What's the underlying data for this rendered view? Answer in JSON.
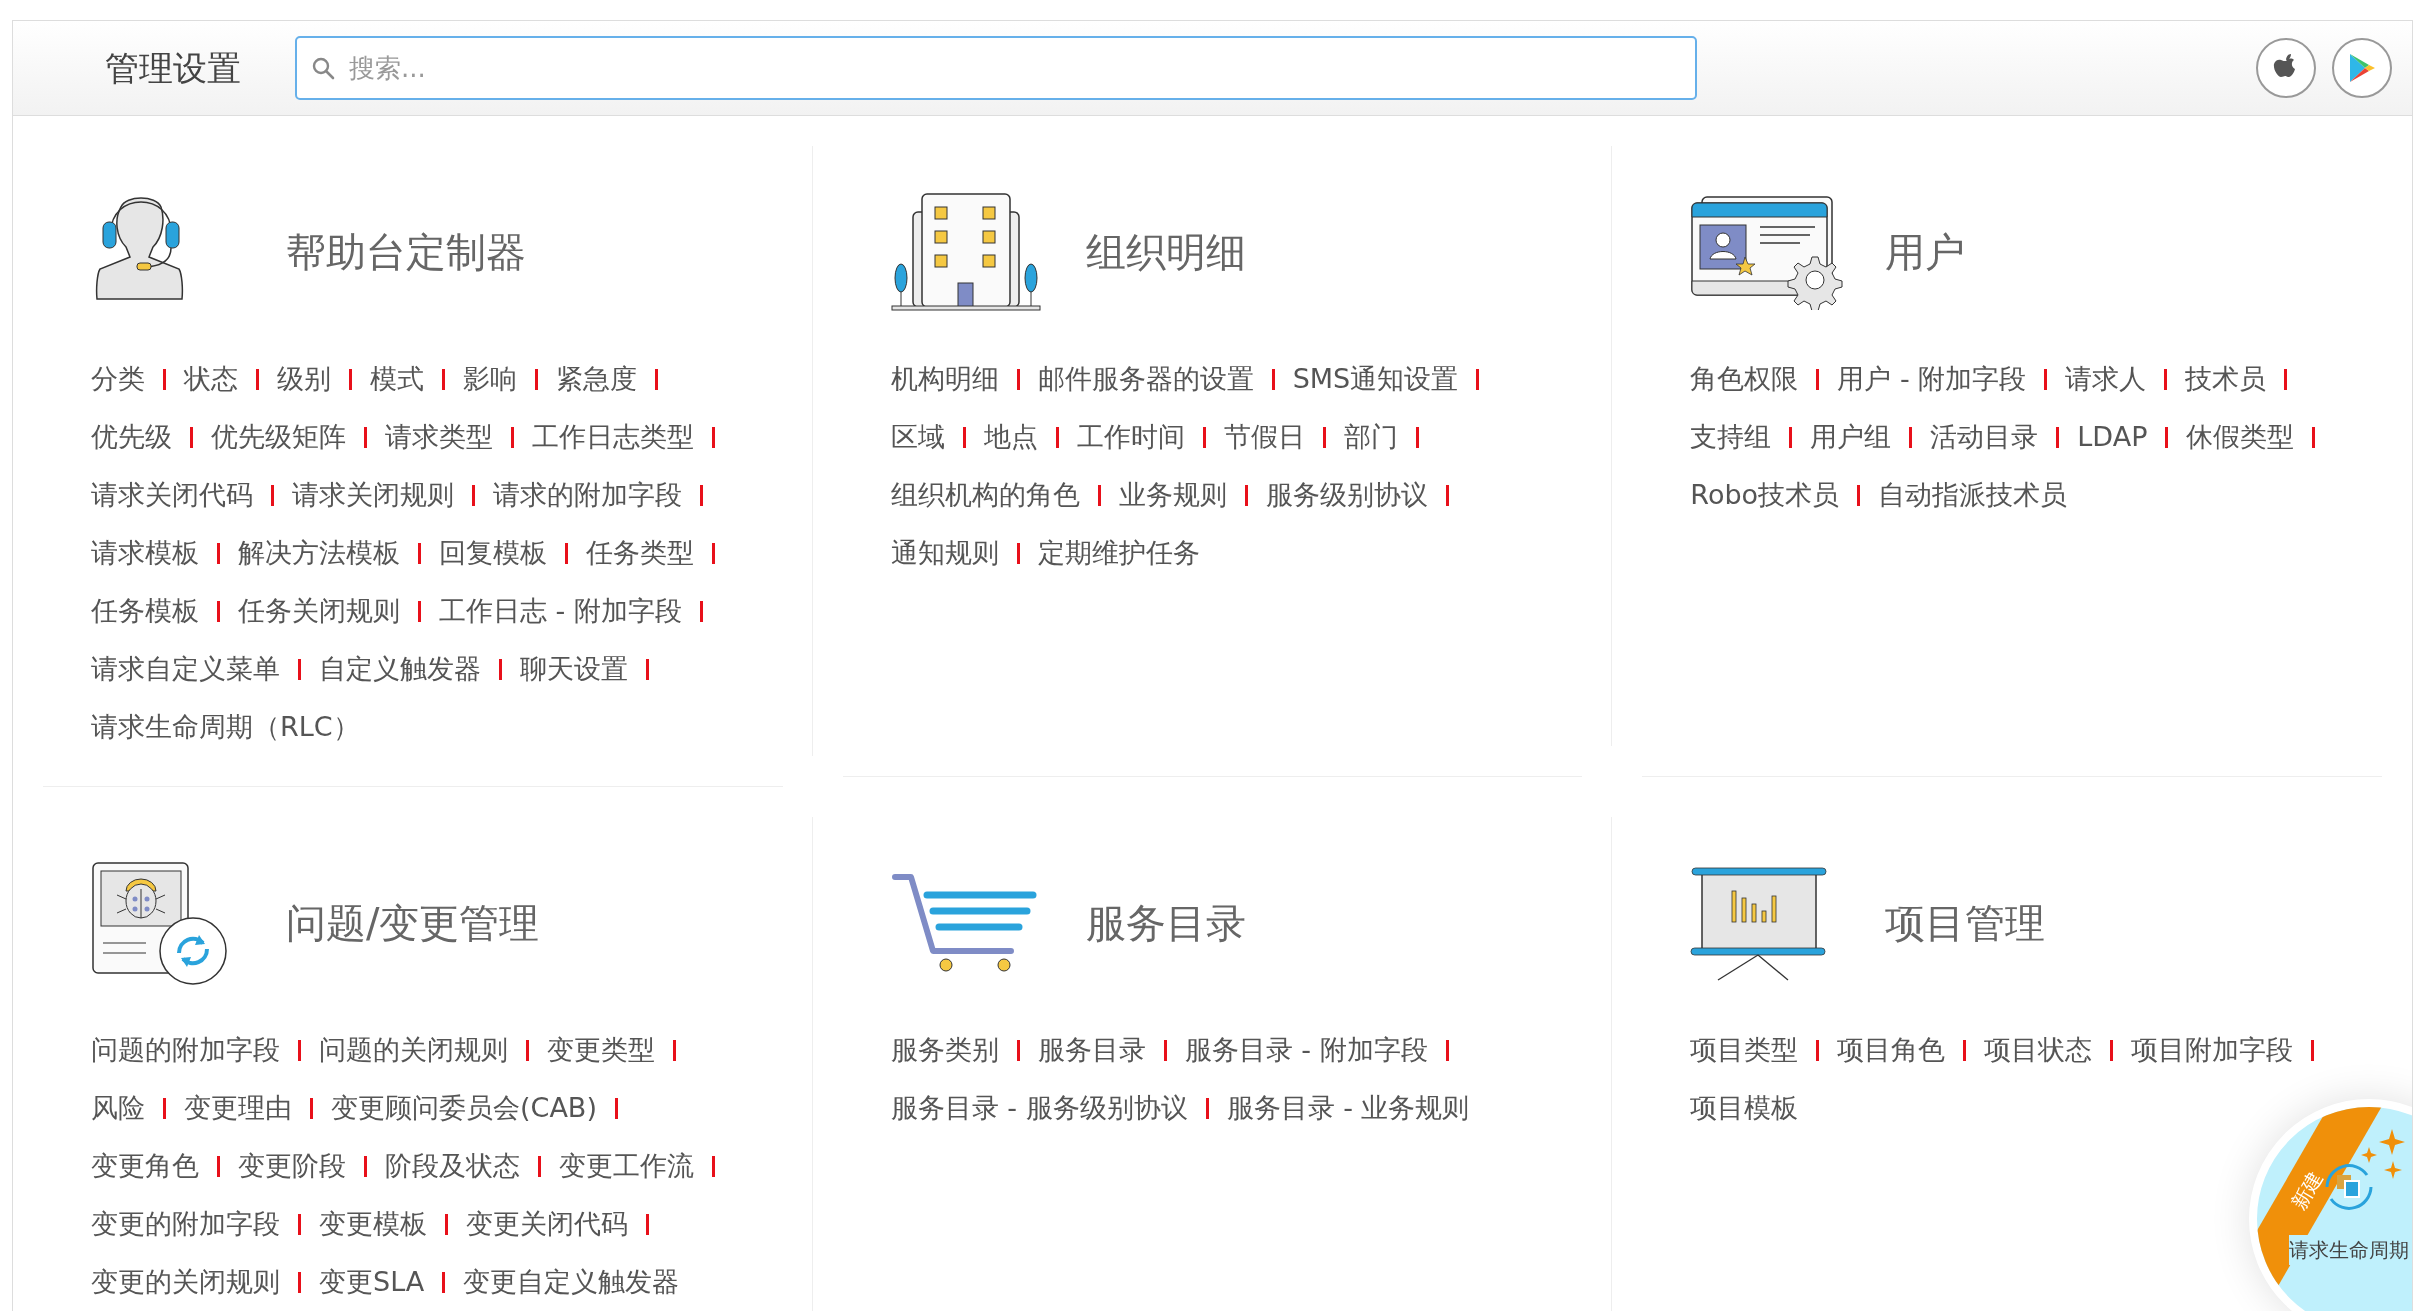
{
  "header": {
    "title": "管理设置",
    "search": {
      "placeholder": "搜索..."
    }
  },
  "sections": [
    {
      "title": "帮助台定制器",
      "links": [
        "分类",
        "状态",
        "级别",
        "模式",
        "影响",
        "紧急度",
        "优先级",
        "优先级矩阵",
        "请求类型",
        "工作日志类型",
        "请求关闭代码",
        "请求关闭规则",
        "请求的附加字段",
        "请求模板",
        "解决方法模板",
        "回复模板",
        "任务类型",
        "任务模板",
        "任务关闭规则",
        "工作日志 - 附加字段",
        "请求自定义菜单",
        "自定义触发器",
        "聊天设置",
        "请求生命周期（RLC）"
      ]
    },
    {
      "title": "组织明细",
      "links": [
        "机构明细",
        "邮件服务器的设置",
        "SMS通知设置",
        "区域",
        "地点",
        "工作时间",
        "节假日",
        "部门",
        "组织机构的角色",
        "业务规则",
        "服务级别协议",
        "通知规则",
        "定期维护任务"
      ]
    },
    {
      "title": "用户",
      "links": [
        "角色权限",
        "用户 - 附加字段",
        "请求人",
        "技术员",
        "支持组",
        "用户组",
        "活动目录",
        "LDAP",
        "休假类型",
        "Robo技术员",
        "自动指派技术员"
      ]
    },
    {
      "title": "问题/变更管理",
      "links": [
        "问题的附加字段",
        "问题的关闭规则",
        "变更类型",
        "风险",
        "变更理由",
        "变更顾问委员会(CAB)",
        "变更角色",
        "变更阶段",
        "阶段及状态",
        "变更工作流",
        "变更的附加字段",
        "变更模板",
        "变更关闭代码",
        "变更的关闭规则",
        "变更SLA",
        "变更自定义触发器"
      ]
    },
    {
      "title": "服务目录",
      "links": [
        "服务类别",
        "服务目录",
        "服务目录 - 附加字段",
        "服务目录 - 服务级别协议",
        "服务目录 - 业务规则"
      ]
    },
    {
      "title": "项目管理",
      "links": [
        "项目类型",
        "项目角色",
        "项目状态",
        "项目附加字段",
        "项目模板"
      ]
    }
  ],
  "floating_badge": {
    "ribbon": "新建",
    "label": "请求生命周期"
  }
}
